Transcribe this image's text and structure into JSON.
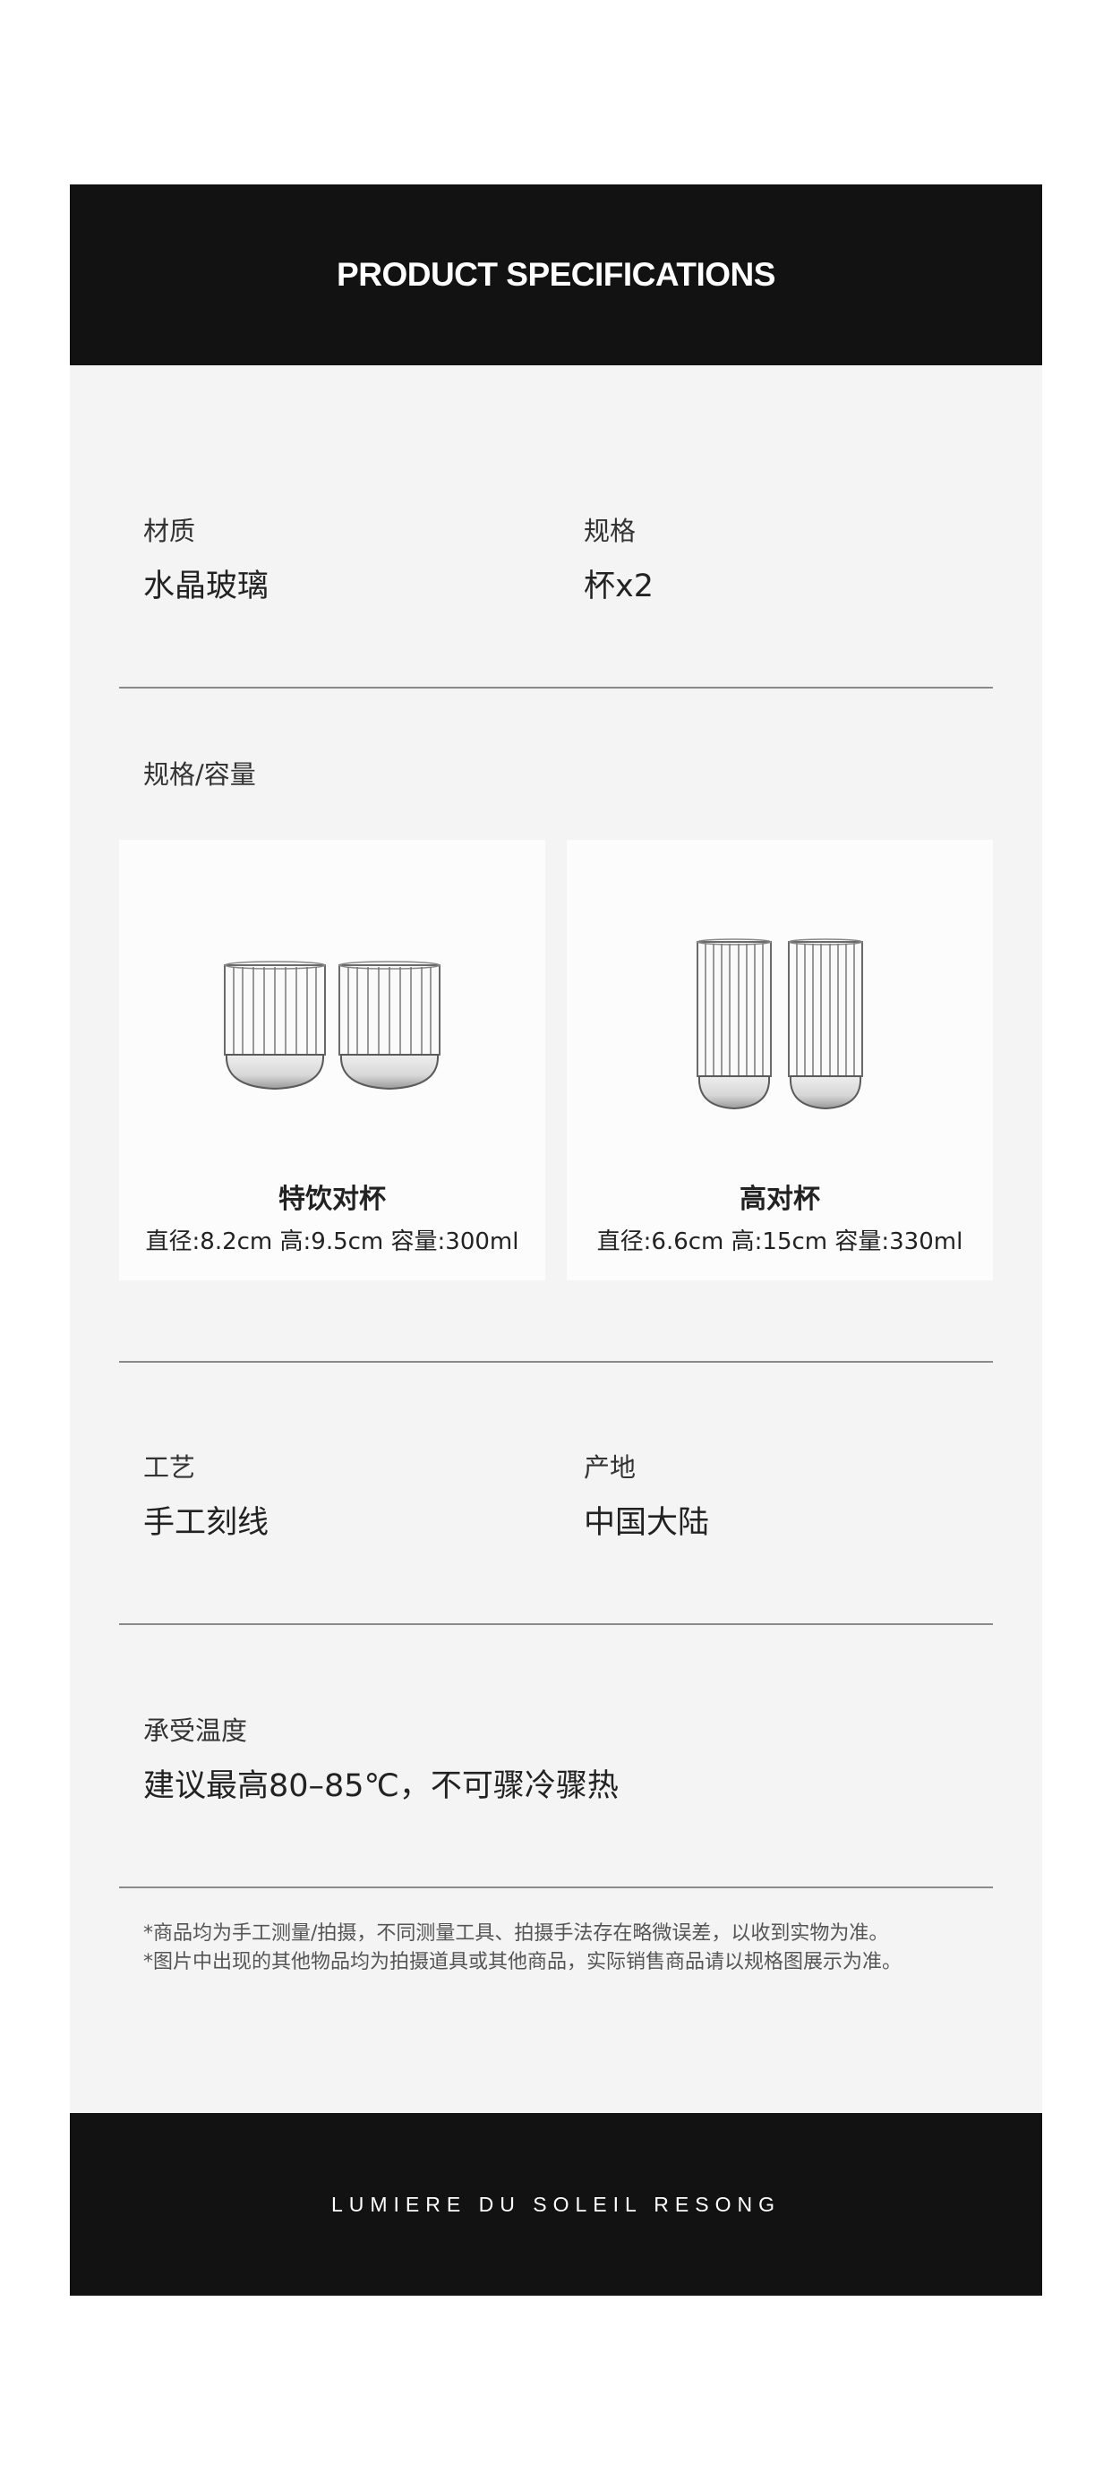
{
  "header": {
    "title": "PRODUCT SPECIFICATIONS"
  },
  "specs": {
    "material": {
      "label": "材质",
      "value": "水晶玻璃"
    },
    "spec": {
      "label": "规格",
      "value": "杯x2"
    },
    "capacity_label": "规格/容量",
    "products": [
      {
        "name": "特饮对杯",
        "dims": "直径:8.2cm 高:9.5cm 容量:300ml"
      },
      {
        "name": "高对杯",
        "dims": "直径:6.6cm 高:15cm 容量:330ml"
      }
    ],
    "craft": {
      "label": "工艺",
      "value": "手工刻线"
    },
    "origin": {
      "label": "产地",
      "value": "中国大陆"
    },
    "temperature": {
      "label": "承受温度",
      "value": "建议最高80–85℃，不可骤冷骤热"
    }
  },
  "notes": [
    "*商品均为手工测量/拍摄，不同测量工具、拍摄手法存在略微误差，以收到实物为准。",
    "*图片中出现的其他物品均为拍摄道具或其他商品，实际销售商品请以规格图展示为准。"
  ],
  "footer": {
    "brand": "LUMIERE DU SOLEIL RESONG"
  }
}
